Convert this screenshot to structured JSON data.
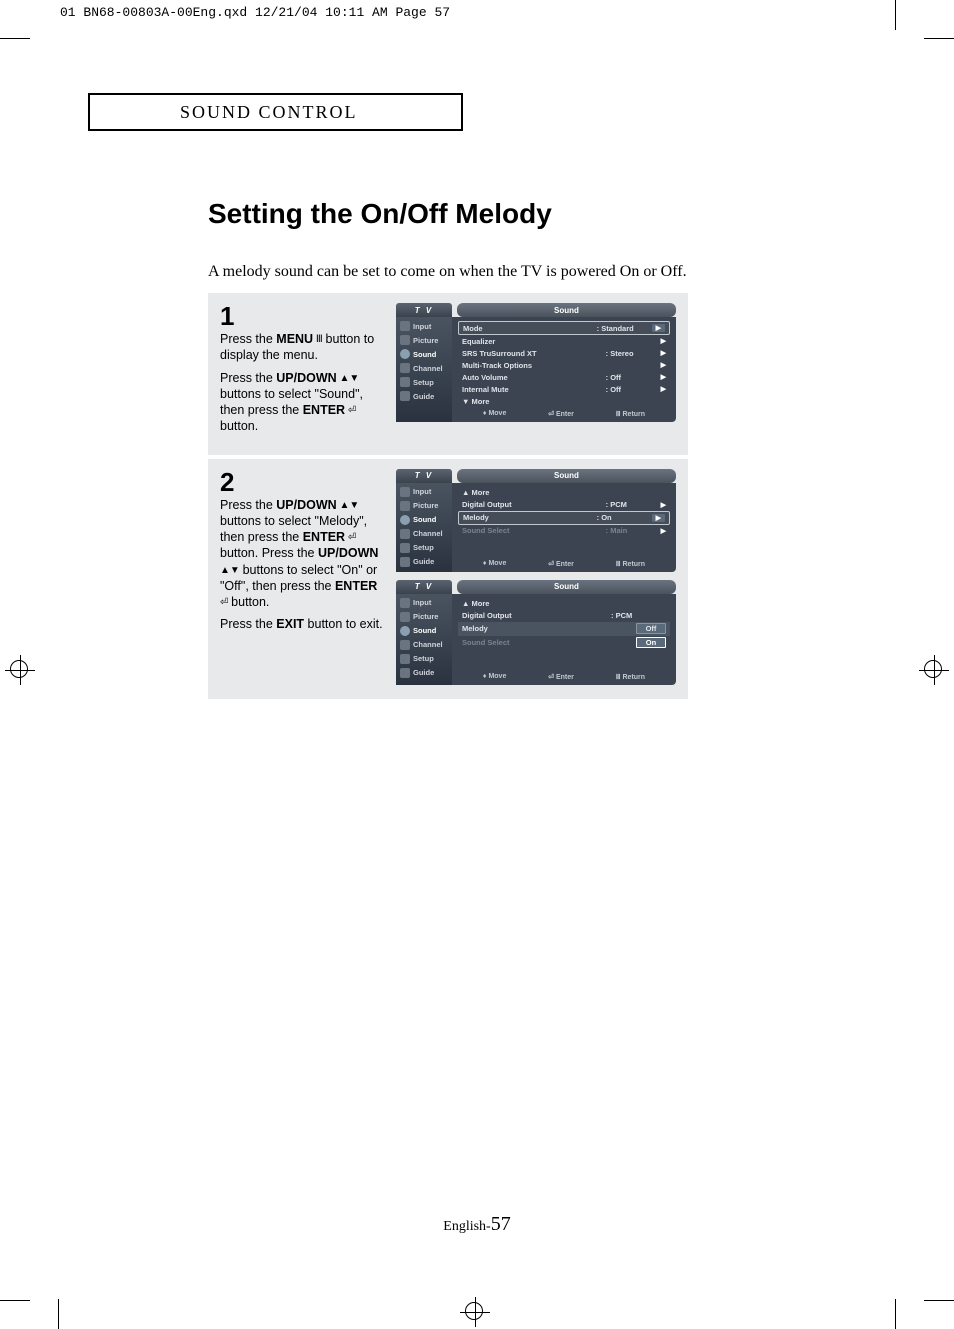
{
  "print_header": "01 BN68-00803A-00Eng.qxd  12/21/04 10:11 AM  Page 57",
  "section_title": "SOUND CONTROL",
  "page_title": "Setting the On/Off Melody",
  "intro": "A melody sound can be set to come on when the TV is powered On or Off.",
  "step1": {
    "num": "1",
    "line1a": "Press the ",
    "line1b": "MENU",
    "line1c": " button to display the menu.",
    "line2a": "Press the ",
    "line2b": "UP/DOWN",
    "line2c": " buttons to select \"Sound\", then press the ",
    "line2d": "ENTER",
    "line2e": " button."
  },
  "step2": {
    "num": "2",
    "line1a": "Press the ",
    "line1b": "UP/DOWN",
    "line1c": " buttons to select \"Melody\", then press the ",
    "line1d": "ENTER",
    "line1e": " button. Press the ",
    "line1f": "UP/DOWN",
    "line1g": " buttons to select \"On\" or \"Off\", then press the ",
    "line1h": "ENTER",
    "line1i": " button.",
    "line2a": "Press the ",
    "line2b": "EXIT",
    "line2c": " button to exit."
  },
  "osd_common": {
    "tv": "T V",
    "sound": "Sound",
    "side": [
      "Input",
      "Picture",
      "Sound",
      "Channel",
      "Setup",
      "Guide"
    ],
    "foot_move": "Move",
    "foot_enter": "Enter",
    "foot_return": "Return"
  },
  "osd1": {
    "rows": [
      {
        "lbl": "Mode",
        "val": ": Standard",
        "sel": true,
        "arrbox": true
      },
      {
        "lbl": "Equalizer",
        "val": "",
        "arr": true
      },
      {
        "lbl": "SRS TruSurround XT",
        "val": ": Stereo",
        "arr": true
      },
      {
        "lbl": "Multi-Track Options",
        "val": "",
        "arr": true
      },
      {
        "lbl": "Auto Volume",
        "val": ": Off",
        "arr": true
      },
      {
        "lbl": "Internal Mute",
        "val": ": Off",
        "arr": true
      },
      {
        "lbl": "▼ More",
        "val": ""
      }
    ]
  },
  "osd2": {
    "rows": [
      {
        "lbl": "▲ More",
        "val": ""
      },
      {
        "lbl": "Digital Output",
        "val": ": PCM",
        "arr": true
      },
      {
        "lbl": "Melody",
        "val": ": On",
        "sel": true,
        "arrbox": true
      },
      {
        "lbl": "Sound Select",
        "val": ": Main",
        "dim": true,
        "arr": true
      }
    ]
  },
  "osd3": {
    "rows": [
      {
        "lbl": "▲ More",
        "val": ""
      },
      {
        "lbl": "Digital Output",
        "val": ": PCM"
      },
      {
        "lbl": "Melody",
        "val": "Off",
        "valbox": true,
        "highlight": true
      },
      {
        "lbl": "Sound Select",
        "val": "On",
        "dim": true,
        "valbox": true,
        "sel": true
      }
    ]
  },
  "page_number_prefix": "English-",
  "page_number": "57"
}
